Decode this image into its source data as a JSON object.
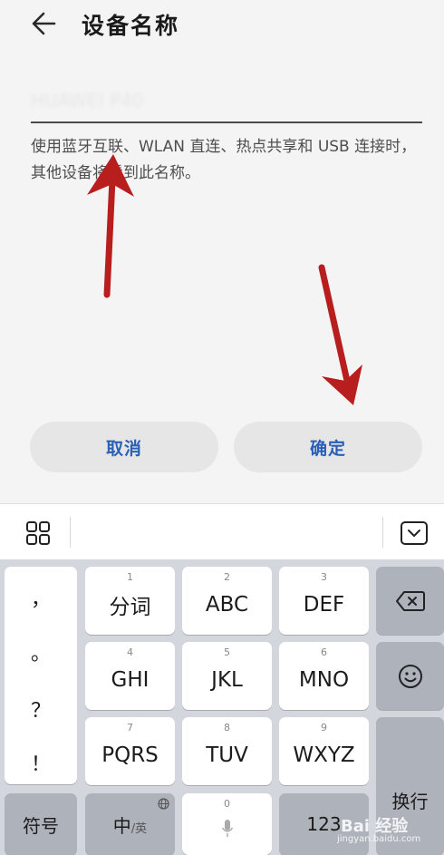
{
  "header": {
    "title": "设备名称",
    "back_icon": "arrow-left-icon"
  },
  "form": {
    "device_name_value": "HUAWEI P40",
    "description": "使用蓝牙互联、WLAN 直连、热点共享和 USB 连接时，其他设备将看到此名称。"
  },
  "actions": {
    "cancel_label": "取消",
    "confirm_label": "确定",
    "accent_color": "#2a5fb8"
  },
  "annotations": {
    "arrow_color": "#b81e1e"
  },
  "keyboard": {
    "toolbar": {
      "left_icon": "grid-icon",
      "right_icon": "keyboard-collapse-icon"
    },
    "punctuation": [
      "，",
      "。",
      "？",
      "！"
    ],
    "keys": [
      {
        "num": "1",
        "label": "分词"
      },
      {
        "num": "2",
        "label": "ABC"
      },
      {
        "num": "3",
        "label": "DEF"
      },
      {
        "num": "4",
        "label": "GHI"
      },
      {
        "num": "5",
        "label": "JKL"
      },
      {
        "num": "6",
        "label": "MNO"
      },
      {
        "num": "7",
        "label": "PQRS"
      },
      {
        "num": "8",
        "label": "TUV"
      },
      {
        "num": "9",
        "label": "WXYZ"
      }
    ],
    "backspace_icon": "backspace-icon",
    "emoji_icon": "emoji-icon",
    "enter_label": "换行",
    "symbols_label": "符号",
    "lang_label_main": "中",
    "lang_label_sub": "/英",
    "space_num": "0",
    "space_icon": "microphone-icon",
    "num_label": "123",
    "globe_icon": "globe-icon"
  },
  "watermark": {
    "text": "Bai 经验",
    "sub": "jingyan.baidu.com"
  }
}
